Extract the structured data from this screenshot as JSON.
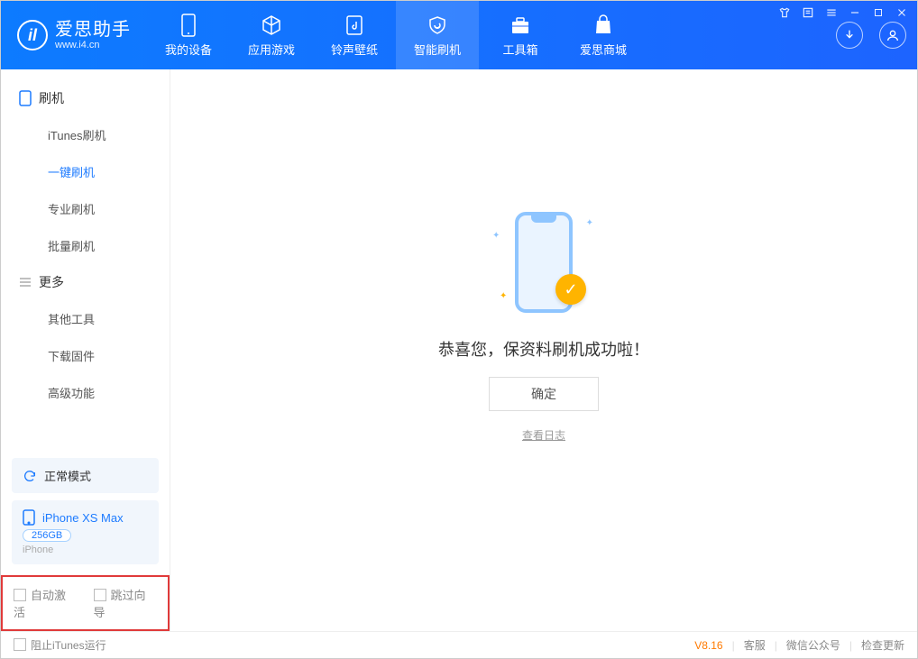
{
  "app": {
    "title": "爱思助手",
    "subtitle": "www.i4.cn"
  },
  "nav": {
    "items": [
      {
        "label": "我的设备"
      },
      {
        "label": "应用游戏"
      },
      {
        "label": "铃声壁纸"
      },
      {
        "label": "智能刷机"
      },
      {
        "label": "工具箱"
      },
      {
        "label": "爱思商城"
      }
    ]
  },
  "sidebar": {
    "group1": "刷机",
    "items1": [
      "iTunes刷机",
      "一键刷机",
      "专业刷机",
      "批量刷机"
    ],
    "group2": "更多",
    "items2": [
      "其他工具",
      "下载固件",
      "高级功能"
    ]
  },
  "device": {
    "mode": "正常模式",
    "name": "iPhone XS Max",
    "capacity": "256GB",
    "type": "iPhone"
  },
  "options": {
    "auto_activate": "自动激活",
    "skip_guide": "跳过向导"
  },
  "main": {
    "success_text": "恭喜您，保资料刷机成功啦！",
    "ok_button": "确定",
    "view_log": "查看日志"
  },
  "footer": {
    "block_itunes": "阻止iTunes运行",
    "version": "V8.16",
    "customer_service": "客服",
    "wechat": "微信公众号",
    "check_update": "检查更新"
  }
}
